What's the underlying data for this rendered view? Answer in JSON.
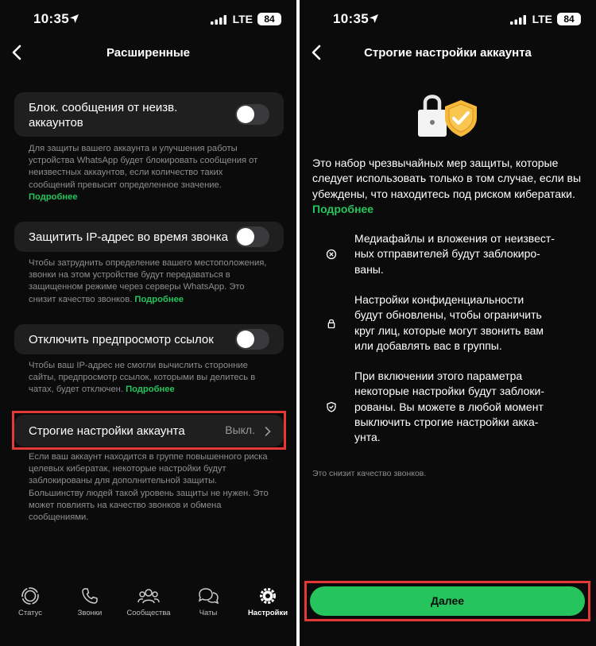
{
  "status_bar": {
    "time": "10:35",
    "network": "LTE",
    "battery": "84"
  },
  "left_screen": {
    "title": "Расширенные",
    "block_unknown": {
      "label_line1": "Блок. сообщения от неизв.",
      "label_line2": "аккаунтов",
      "description": "Для защиты вашего аккаунта и улучшения работы устройства WhatsApp будет блокировать сообщения от неизвестных аккаунтов, если количество таких сообщений превысит определенное значение.",
      "more": "Подробнее"
    },
    "protect_ip": {
      "label": "Защитить IP-адрес во время звонка",
      "description": "Чтобы затруднить определение вашего местоположения, звонки на этом устройстве будут передаваться в защищенном режиме через серверы WhatsApp. Это снизит качество звонков.",
      "more": "Подробнее"
    },
    "link_preview": {
      "label": "Отключить предпросмотр ссылок",
      "description": "Чтобы ваш IP-адрес не смогли вычислить сторонние сайты, предпросмотр ссылок, которыми вы делитесь в чатах, будет отключен.",
      "more": "Подробнее"
    },
    "strict": {
      "label": "Строгие настройки аккаунта",
      "value": "Выкл.",
      "description": "Если ваш аккаунт находится в группе повышенного риска целевых кибератак, некоторые настройки будут заблокированы для дополнительной защиты. Большинству людей такой уровень защиты не нужен. Это может повлиять на качество звонков и обмена сообщениями."
    },
    "tabs": [
      {
        "label": "Статус",
        "icon": "status-icon"
      },
      {
        "label": "Звонки",
        "icon": "phone-icon"
      },
      {
        "label": "Сообщества",
        "icon": "communities-icon"
      },
      {
        "label": "Чаты",
        "icon": "chats-icon"
      },
      {
        "label": "Настройки",
        "icon": "settings-icon"
      }
    ]
  },
  "right_screen": {
    "title": "Строгие настройки аккаунта",
    "intro": "Это набор чрезвычайных мер защиты, которые следует использовать только в том случае, если вы убеждены, что находитесь под риском кибератаки.",
    "intro_more": "Подробнее",
    "features": [
      {
        "icon": "block-icon",
        "lines": [
          "Медиафайлы и вложения от неизвест-",
          "ных отправителей будут заблокиро-",
          "ваны."
        ]
      },
      {
        "icon": "lock-icon",
        "lines": [
          "Настройки конфиденциальности",
          "будут обновлены, чтобы ограничить",
          "круг лиц, которые могут звонить вам",
          "или добавлять вас в группы."
        ]
      },
      {
        "icon": "shield-icon",
        "lines": [
          "При включении этого параметра",
          "некоторые настройки будут заблоки-",
          "рованы. Вы можете в любой момент",
          "выключить строгие настройки акка-",
          "унта."
        ]
      }
    ],
    "note": "Это снизит качество звонков.",
    "next_button": "Далее"
  },
  "colors": {
    "accent": "#25c45c",
    "highlight": "#e53935",
    "background": "#0b0b0b",
    "card": "#1f1f1f"
  }
}
